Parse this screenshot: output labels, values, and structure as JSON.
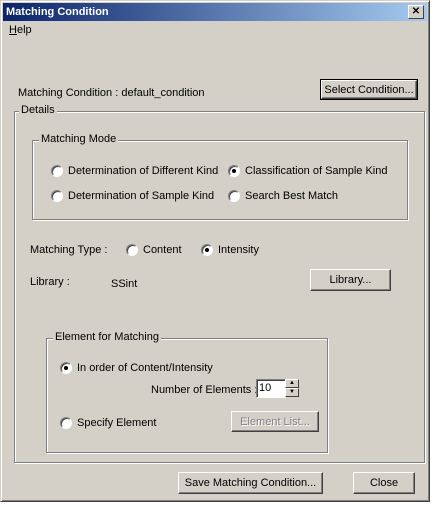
{
  "window": {
    "title": "Matching Condition",
    "close_glyph": "✕"
  },
  "menu": {
    "help_first": "H",
    "help_rest": "elp"
  },
  "condition": {
    "label": "Matching Condition : default_condition",
    "select_button": "Select Condition..."
  },
  "details": {
    "label": "Details",
    "matching_mode": {
      "label": "Matching Mode",
      "options": [
        {
          "label": "Determination of Different Kind",
          "checked": false
        },
        {
          "label": "Classification of Sample Kind",
          "checked": true
        },
        {
          "label": "Determination of Sample Kind",
          "checked": false
        },
        {
          "label": "Search Best Match",
          "checked": false
        }
      ]
    },
    "matching_type": {
      "label": "Matching Type :",
      "options": [
        {
          "label": "Content",
          "checked": false
        },
        {
          "label": "Intensity",
          "checked": true
        }
      ]
    },
    "library": {
      "label": "Library :",
      "value": "SSint",
      "button": "Library..."
    },
    "element": {
      "label": "Element for Matching",
      "order_option": {
        "label": "In order of Content/Intensity",
        "checked": true
      },
      "number_label": "Number of Elements :",
      "number_value": "10",
      "specify_option": {
        "label": "Specify Element",
        "checked": false
      },
      "element_list_button": "Element List..."
    }
  },
  "footer": {
    "save_button": "Save Matching Condition...",
    "close_button": "Close"
  },
  "colors": {
    "title_start": "#0a246a",
    "title_end": "#a6caf0",
    "face": "#d4d0c8"
  }
}
